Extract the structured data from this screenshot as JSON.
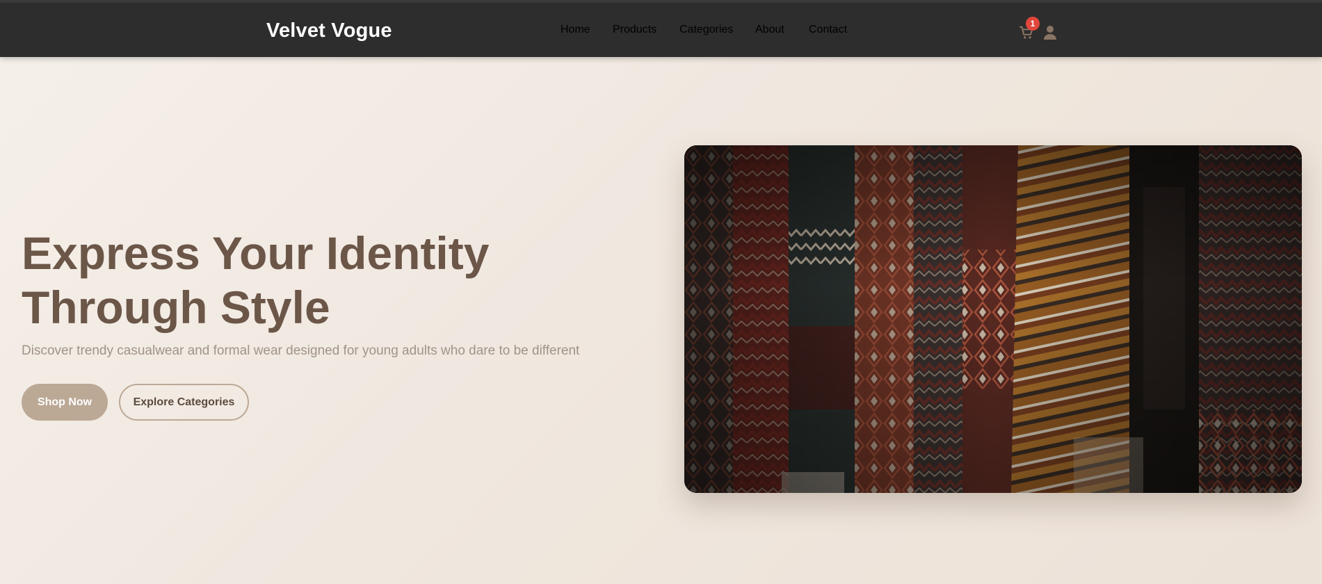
{
  "header": {
    "brand": "Velvet Vogue",
    "nav": [
      {
        "label": "Home",
        "active": true
      },
      {
        "label": "Products",
        "active": false
      },
      {
        "label": "Categories",
        "active": false
      },
      {
        "label": "About",
        "active": false
      },
      {
        "label": "Contact",
        "active": false
      }
    ],
    "cart_count": "1",
    "icons": {
      "cart": "cart-icon",
      "user": "user-icon"
    }
  },
  "hero": {
    "title_line1": "Express Your Identity",
    "title_line2": "Through Style",
    "subtitle": "Discover trendy casualwear and formal wear designed for young adults who dare to be different",
    "primary_button": "Shop Now",
    "secondary_button": "Explore Categories",
    "image_subject": "hanging patterned woven kilim textiles"
  },
  "colors": {
    "header_bg": "#2d2d2d",
    "accent": "#c8ae93",
    "title": "#6b5648",
    "button": "#bba895",
    "badge": "#e0463b"
  }
}
